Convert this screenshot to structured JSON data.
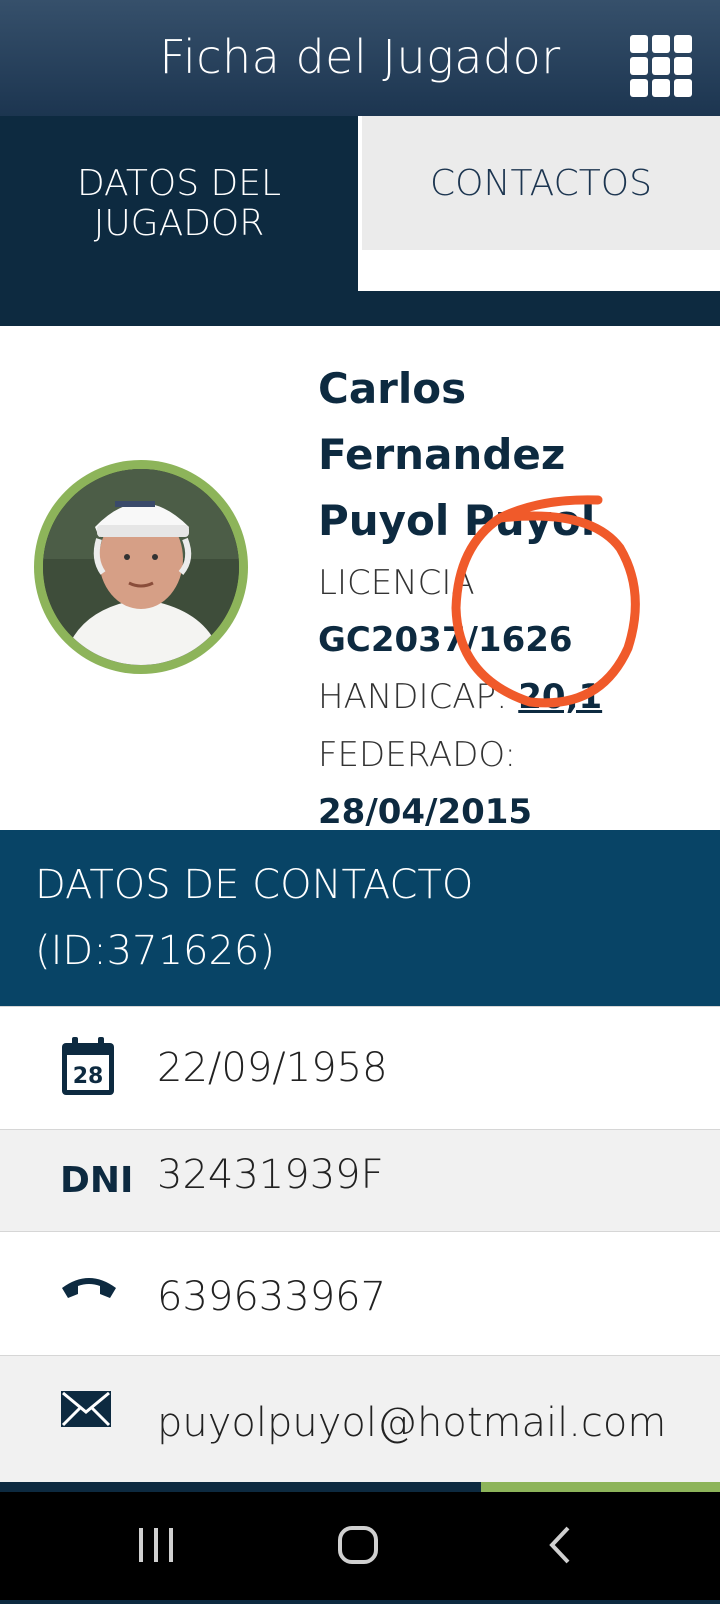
{
  "header": {
    "title": "Ficha del Jugador",
    "menu_icon": "grid-icon"
  },
  "tabs": [
    {
      "label": "DATOS DEL JUGADOR",
      "active": true
    },
    {
      "label": "CONTACTOS",
      "active": false
    }
  ],
  "player": {
    "name_line1": "Carlos Fernandez",
    "name_line2": "Puyol Puyol",
    "license_label": "LICENCIA",
    "license_value": "GC2037/1626",
    "handicap_label": "HANDICAP:",
    "handicap_value": "20,1",
    "federado_label": "FEDERADO:",
    "federado_value": "28/04/2015"
  },
  "contact": {
    "title_line1": "DATOS DE CONTACTO",
    "title_line2": "(ID:371626)",
    "birthdate": "22/09/1958",
    "calendar_day": "28",
    "dni_label": "DNI",
    "dni": "32431939F",
    "phone": "639633967",
    "email": "puyolpuyol@hotmail.com"
  },
  "colors": {
    "primary": "#0d2a40",
    "contact_header": "#084466",
    "accent_green": "#8db45a",
    "annotation": "#f05a2a"
  }
}
